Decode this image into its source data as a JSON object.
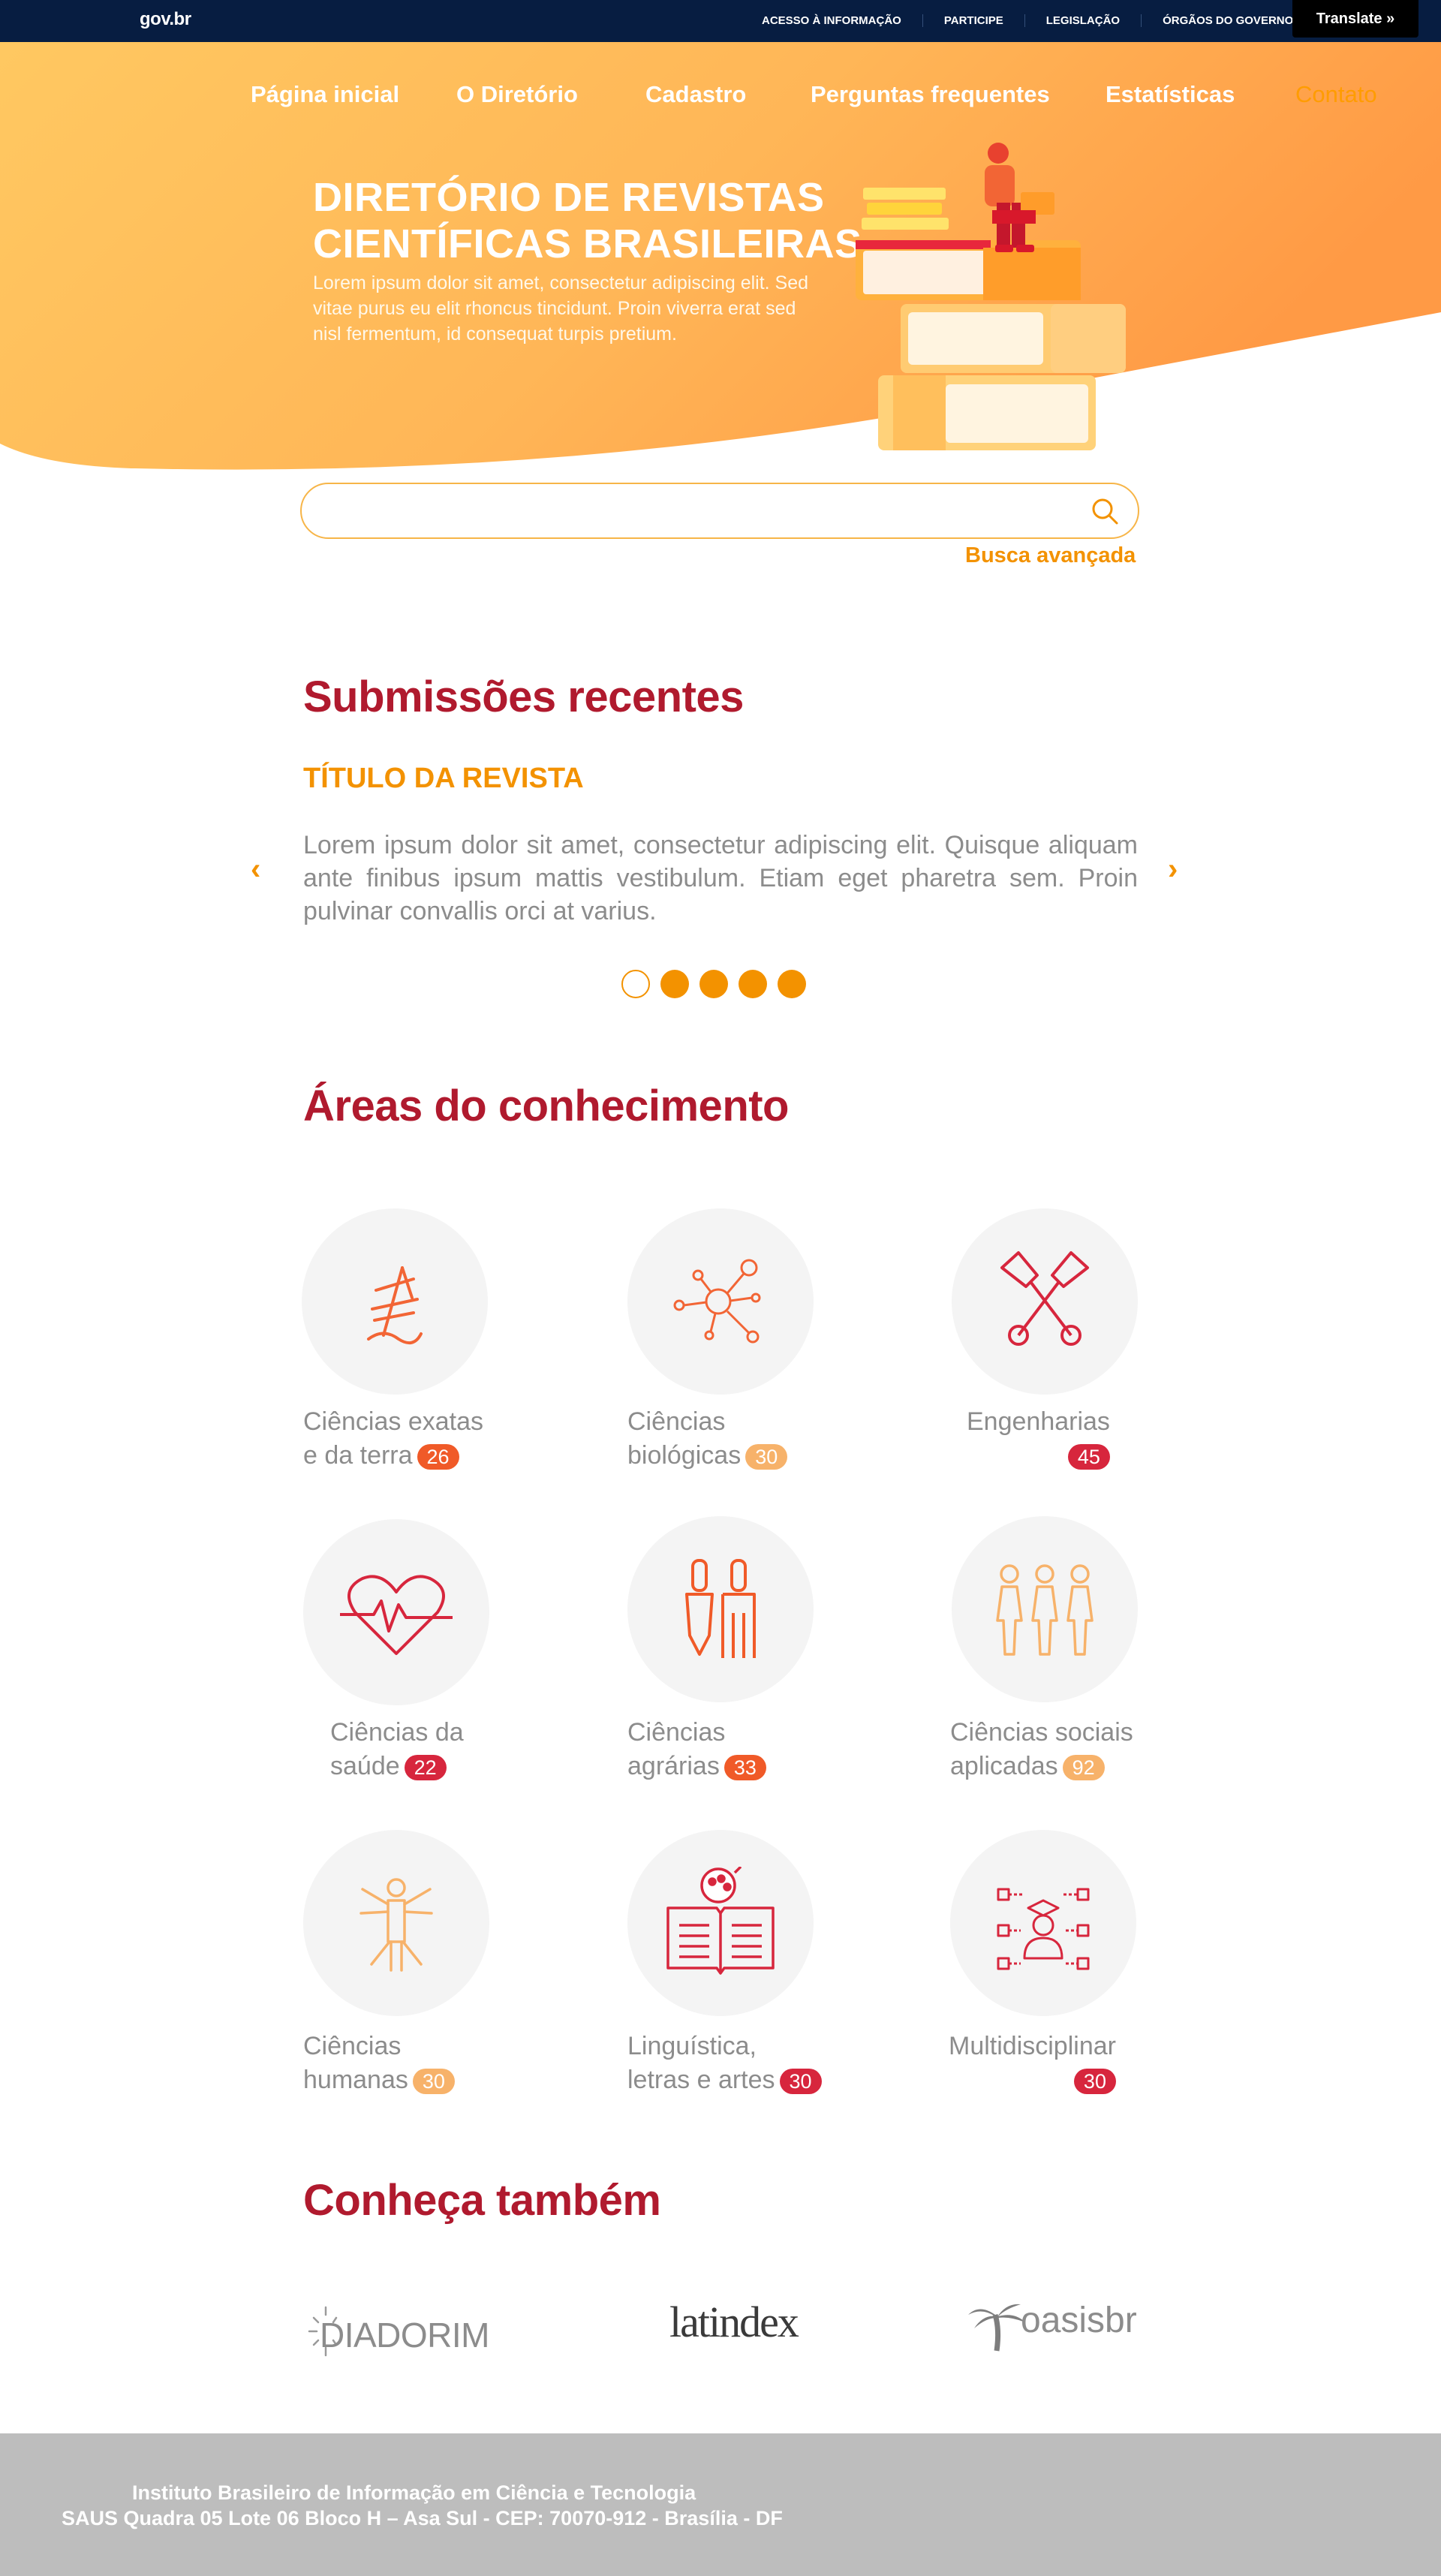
{
  "govbar": {
    "logo": "gov.br",
    "links": [
      "ACESSO À INFORMAÇÃO",
      "PARTICIPE",
      "LEGISLAÇÃO",
      "ÓRGÃOS DO GOVERNO"
    ],
    "translate": "Translate »"
  },
  "nav": {
    "items": [
      "Página inicial",
      "O Diretório",
      "Cadastro",
      "Perguntas frequentes",
      "Estatísticas",
      "Contato"
    ],
    "active": "Contato"
  },
  "hero": {
    "title_line1": "DIRETÓRIO DE REVISTAS",
    "title_line2": "CIENTÍFICAS BRASILEIRAS",
    "text": "Lorem ipsum dolor sit amet, consectetur adipiscing elit. Sed vitae purus eu elit rhoncus tincidunt. Proin viverra erat sed nisl fermentum, id consequat turpis pretium."
  },
  "search": {
    "placeholder": "",
    "advanced_label": "Busca avançada"
  },
  "recent": {
    "heading": "Submissões recentes",
    "journal_title": "TÍTULO DA REVISTA",
    "journal_text": "Lorem ipsum dolor sit amet, consectetur adipiscing elit. Quisque aliquam ante finibus ipsum mattis vestibulum. Etiam eget pharetra sem. Proin pulvinar convallis orci at varius.",
    "prev_arrow": "‹",
    "next_arrow": "›",
    "pages": 5,
    "current_page": 1
  },
  "areas": {
    "heading": "Áreas do conhecimento",
    "items": [
      {
        "line1": "Ciências exatas",
        "line2": "e da terra",
        "count": "26",
        "icon": "exact-sciences-icon",
        "badge_color": "#f05a28"
      },
      {
        "line1": "Ciências",
        "line2": "biológicas",
        "count": "30",
        "icon": "molecule-icon",
        "badge_color": "#f7b26a"
      },
      {
        "line1": "Engenharias",
        "line2": "",
        "count": "45",
        "icon": "engineering-tools-icon",
        "badge_color": "#d7263d"
      },
      {
        "line1": "Ciências da",
        "line2": "saúde",
        "count": "22",
        "icon": "heartbeat-icon",
        "badge_color": "#d7263d"
      },
      {
        "line1": "Ciências",
        "line2": "agrárias",
        "count": "33",
        "icon": "gardening-tools-icon",
        "badge_color": "#f05a28"
      },
      {
        "line1": "Ciências sociais",
        "line2": "aplicadas",
        "count": "92",
        "icon": "people-icon",
        "badge_color": "#f7b26a"
      },
      {
        "line1": "Ciências",
        "line2": "humanas",
        "count": "30",
        "icon": "vitruvian-man-icon",
        "badge_color": "#f7b26a"
      },
      {
        "line1": "Linguística,",
        "line2": "letras e artes",
        "count": "30",
        "icon": "book-palette-icon",
        "badge_color": "#d7263d"
      },
      {
        "line1": "Multidisciplinar",
        "line2": "",
        "count": "30",
        "icon": "graduate-network-icon",
        "badge_color": "#d7263d"
      }
    ]
  },
  "partners": {
    "heading": "Conheça também",
    "logos": [
      "DIADORIM",
      "latindex",
      "oasisbr"
    ]
  },
  "footer": {
    "line1": "Instituto Brasileiro de Informação em Ciência e Tecnologia",
    "line2": "SAUS Quadra 05 Lote 06 Bloco H – Asa Sul - CEP: 70070-912 - Brasília - DF"
  },
  "colors": {
    "gov_blue": "#071d41",
    "accent_orange": "#f39200",
    "heading_red": "#b01a2e",
    "footer_gray": "#bdbdbd"
  }
}
